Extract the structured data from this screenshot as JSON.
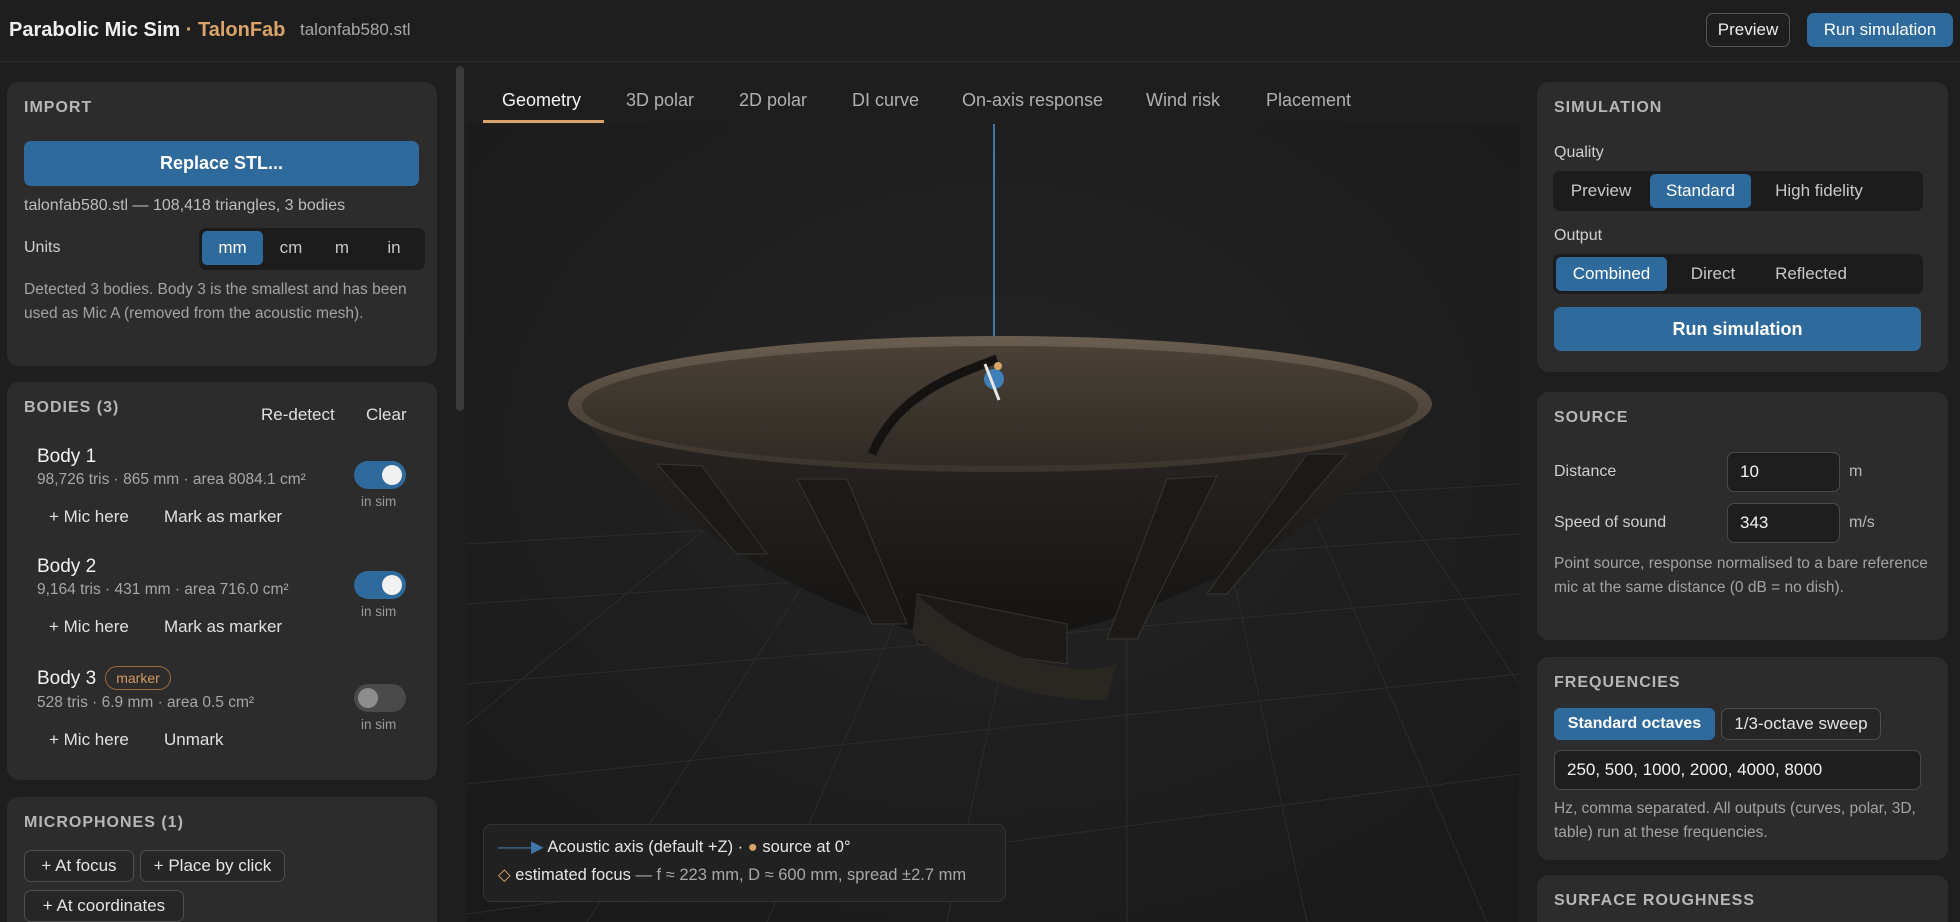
{
  "header": {
    "app_name": "Parabolic Mic Sim",
    "separator": "·",
    "company": "TalonFab",
    "filename": "talonfab580.stl",
    "preview_label": "Preview",
    "run_label": "Run simulation"
  },
  "import": {
    "title": "IMPORT",
    "replace_label": "Replace STL...",
    "file_info": "talonfab580.stl — 108,418 triangles, 3 bodies",
    "units_label": "Units",
    "units": [
      "mm",
      "cm",
      "m",
      "in"
    ],
    "units_selected": "mm",
    "note": "Detected 3 bodies. Body 3 is the smallest and has been used as Mic A (removed from the acoustic mesh)."
  },
  "bodies": {
    "title": "BODIES (3)",
    "redetect_label": "Re-detect",
    "clear_label": "Clear",
    "in_sim_label": "in sim",
    "items": [
      {
        "name": "Body 1",
        "meta": "98,726 tris · 865 mm · area 8084.1 cm²",
        "action1": "+ Mic here",
        "action2": "Mark as marker",
        "badge": "",
        "in_sim": true
      },
      {
        "name": "Body 2",
        "meta": "9,164 tris · 431 mm · area 716.0 cm²",
        "action1": "+ Mic here",
        "action2": "Mark as marker",
        "badge": "",
        "in_sim": true
      },
      {
        "name": "Body 3",
        "meta": "528 tris · 6.9 mm · area 0.5 cm²",
        "action1": "+ Mic here",
        "action2": "Unmark",
        "badge": "marker",
        "in_sim": false
      }
    ]
  },
  "microphones": {
    "title": "MICROPHONES (1)",
    "at_focus": "+ At focus",
    "place_by_click": "+ Place by click",
    "at_coordinates": "+ At coordinates"
  },
  "tabs": [
    "Geometry",
    "3D polar",
    "2D polar",
    "DI curve",
    "On-axis response",
    "Wind risk",
    "Placement"
  ],
  "active_tab": "Geometry",
  "legend": {
    "line1": "Acoustic axis (default +Z) · ",
    "line1b": "source at 0°",
    "line2_strong": "estimated focus",
    "line2_rest": " — f ≈ 223 mm, D ≈ 600 mm, spread ±2.7 mm"
  },
  "simulation": {
    "title": "SIMULATION",
    "quality_label": "Quality",
    "quality_options": [
      "Preview",
      "Standard",
      "High fidelity"
    ],
    "quality_selected": "Standard",
    "output_label": "Output",
    "output_options": [
      "Combined",
      "Direct",
      "Reflected"
    ],
    "output_selected": "Combined",
    "run_label": "Run simulation"
  },
  "source": {
    "title": "SOURCE",
    "distance_label": "Distance",
    "distance_value": "10",
    "distance_unit": "m",
    "speed_label": "Speed of sound",
    "speed_value": "343",
    "speed_unit": "m/s",
    "note": "Point source, response normalised to a bare reference mic at the same distance (0 dB = no dish)."
  },
  "frequencies": {
    "title": "FREQUENCIES",
    "mode_options": [
      "Standard octaves",
      "1/3-octave sweep"
    ],
    "mode_selected": "Standard octaves",
    "value": "250, 500, 1000, 2000, 4000, 8000",
    "note": "Hz, comma separated. All outputs (curves, polar, 3D, table) run at these frequencies."
  },
  "surface_roughness": {
    "title": "SURFACE ROUGHNESS"
  },
  "colors": {
    "accent": "#2f6a9c",
    "brand": "#d9a36a",
    "panel": "#2c2c2c",
    "background": "#1e1e1e"
  }
}
